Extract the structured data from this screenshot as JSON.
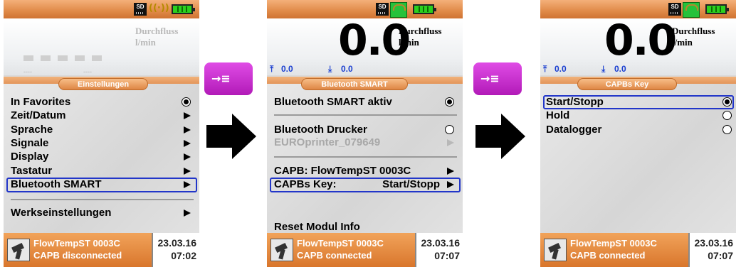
{
  "screens": [
    {
      "measurement": {
        "value": "",
        "label": "Durchfluss",
        "unit": "l/min",
        "dim": true
      },
      "menu_title": "Einstellungen",
      "items": [
        {
          "label": "In Favorites",
          "control": "radio-on"
        },
        {
          "label": "Zeit/Datum",
          "control": "arrow"
        },
        {
          "label": "Sprache",
          "control": "arrow"
        },
        {
          "label": "Signale",
          "control": "arrow"
        },
        {
          "label": "Display",
          "control": "arrow"
        },
        {
          "label": "Tastatur",
          "control": "arrow"
        },
        {
          "label": "Bluetooth SMART",
          "control": "arrow",
          "selected": true
        },
        {
          "label": "Werkseinstellungen",
          "control": "arrow"
        }
      ],
      "footer": {
        "device": "FlowTempST 0003C",
        "status": "CAPB disconnected",
        "date": "23.03.16",
        "time": "07:02"
      }
    },
    {
      "measurement": {
        "value": "0.0",
        "label": "Durchfluss",
        "unit": "l/min",
        "stat_up": "0.0",
        "stat_down": "0.0"
      },
      "menu_title": "Bluetooth SMART",
      "items": [
        {
          "label": "Bluetooth SMART aktiv",
          "control": "radio-on"
        },
        {
          "label": "Bluetooth Drucker",
          "control": "radio-off"
        },
        {
          "label": "EUROprinter_079649",
          "control": "arrow",
          "disabled": true
        },
        {
          "label": "CAPB: FlowTempST 0003C",
          "control": "arrow"
        },
        {
          "label": "CAPBs Key:",
          "value": "Start/Stopp",
          "control": "arrow",
          "selected": true
        },
        {
          "label": "Reset Modul Info",
          "control": "none"
        }
      ],
      "footer": {
        "device": "FlowTempST 0003C",
        "status": "CAPB connected",
        "date": "23.03.16",
        "time": "07:07"
      }
    },
    {
      "measurement": {
        "value": "0.0",
        "label": "Durchfluss",
        "unit": "l/min",
        "stat_up": "0.0",
        "stat_down": "0.0"
      },
      "menu_title": "CAPBs Key",
      "items": [
        {
          "label": "Start/Stopp",
          "control": "radio-on",
          "selected": true
        },
        {
          "label": "Hold",
          "control": "radio-off"
        },
        {
          "label": "Datalogger",
          "control": "radio-off"
        }
      ],
      "footer": {
        "device": "FlowTempST 0003C",
        "status": "CAPB connected",
        "date": "23.03.16",
        "time": "07:07"
      }
    }
  ],
  "status_icons": [
    "sd-card-icon",
    "bluetooth-icon",
    "battery-icon"
  ],
  "accent_color": "#e08a48",
  "nav_button_color": "#c92bcf",
  "selection_color": "#2236c9",
  "small_placeholder": "----"
}
